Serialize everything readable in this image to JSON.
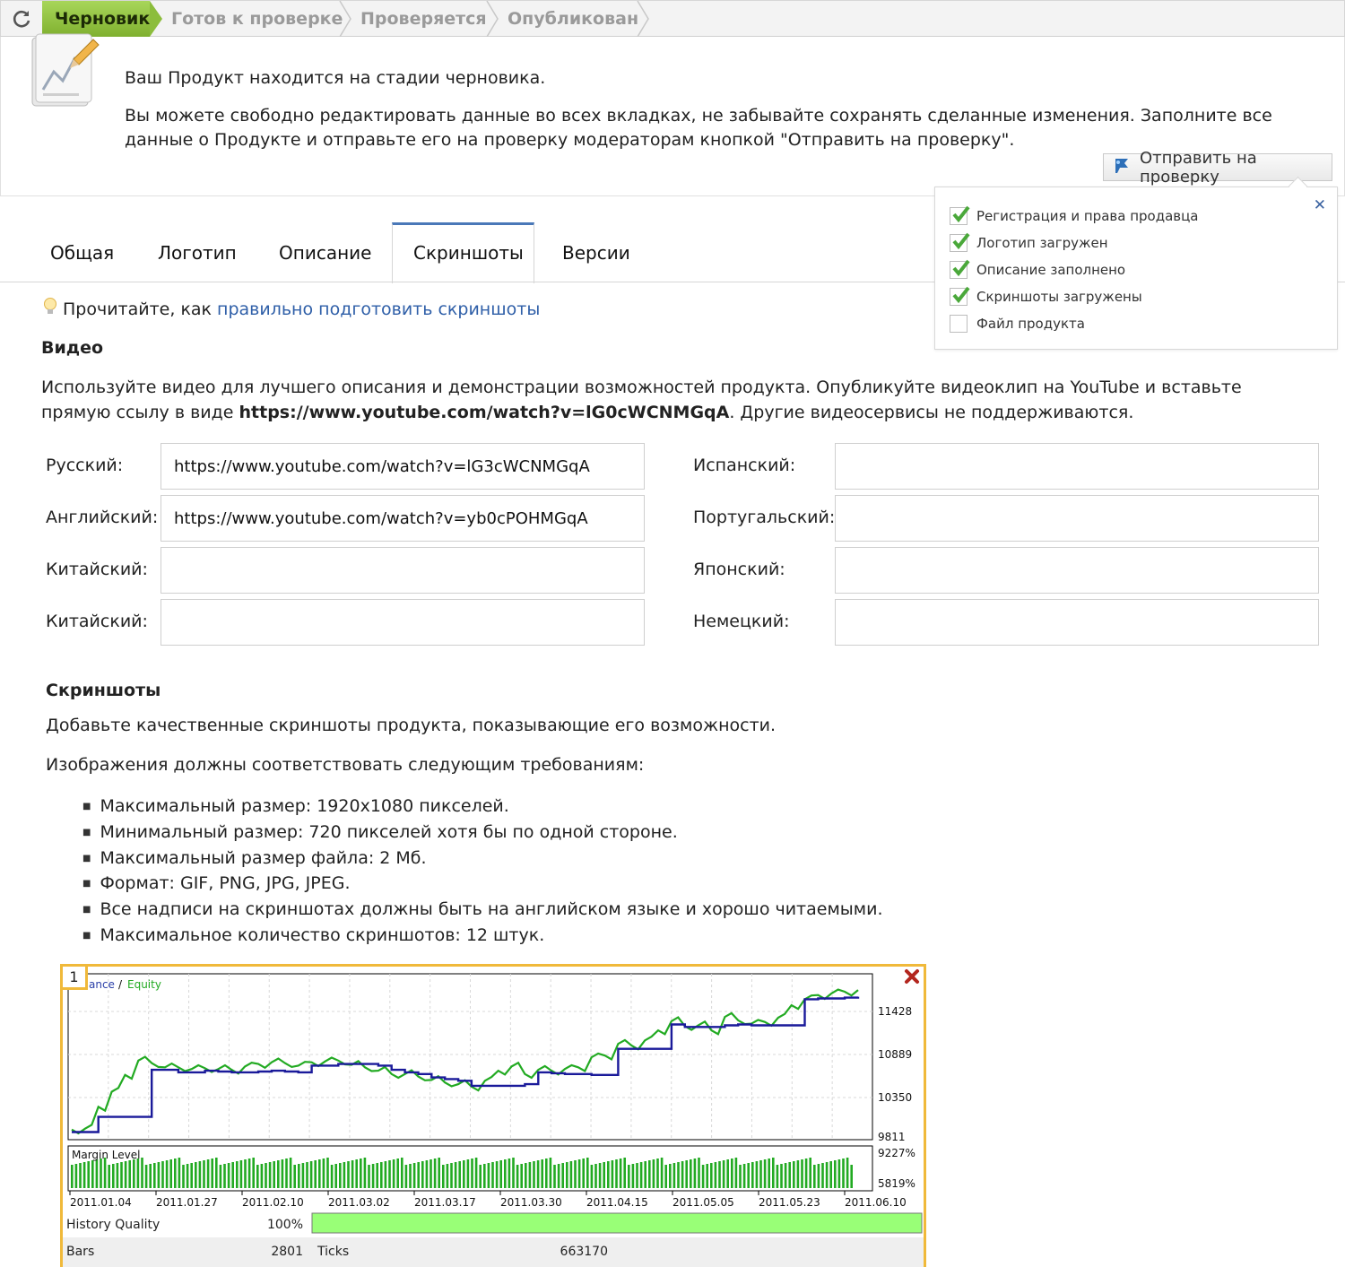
{
  "statusbar": {
    "steps": [
      {
        "label": "Черновик",
        "active": true
      },
      {
        "label": "Готов к проверке",
        "active": false
      },
      {
        "label": "Проверяется",
        "active": false
      },
      {
        "label": "Опубликован",
        "active": false
      }
    ]
  },
  "info": {
    "line1": "Ваш Продукт находится на стадии черновика.",
    "line2": "Вы можете свободно редактировать данные во всех вкладках, не забывайте сохранять сделанные изменения. Заполните все данные о Продукте и отправьте его на проверку модераторам кнопкой \"Отправить на проверку\".",
    "send_button": "Отправить на проверку"
  },
  "checklist": [
    {
      "label": "Регистрация и права продавца",
      "checked": true
    },
    {
      "label": "Логотип загружен",
      "checked": true
    },
    {
      "label": "Описание заполнено",
      "checked": true
    },
    {
      "label": "Скриншоты загружены",
      "checked": true
    },
    {
      "label": "Файл продукта",
      "checked": false
    }
  ],
  "tabs": [
    "Общая",
    "Логотип",
    "Описание",
    "Скриншоты",
    "Версии"
  ],
  "active_tab": "Скриншоты",
  "hint": {
    "prefix": "Прочитайте, как",
    "link": "правильно подготовить скриншоты"
  },
  "video": {
    "heading": "Видео",
    "desc_pre": "Используйте видео для лучшего описания и демонстрации возможностей продукта. Опубликуйте видеоклип на YouTube и вставьте прямую ссылу в виде ",
    "desc_url": "https://www.youtube.com/watch?v=lG0cWCNMGqA",
    "desc_post": ". Другие видеосервисы не поддерживаются.",
    "fields_left": [
      {
        "label": "Русский:",
        "value": "https://www.youtube.com/watch?v=lG3cWCNMGqA"
      },
      {
        "label": "Английский:",
        "value": "https://www.youtube.com/watch?v=yb0cPOHMGqA"
      },
      {
        "label": "Китайский:",
        "value": ""
      },
      {
        "label": "Китайский:",
        "value": ""
      }
    ],
    "fields_right": [
      {
        "label": "Испанский:",
        "value": ""
      },
      {
        "label": "Португальский:",
        "value": ""
      },
      {
        "label": "Японский:",
        "value": ""
      },
      {
        "label": "Немецкий:",
        "value": ""
      }
    ]
  },
  "screenshots": {
    "heading": "Скриншоты",
    "p1": "Добавьте качественные скриншоты продукта, показывающие его возможности.",
    "p2": "Изображения должны соответствовать следующим требованиям:",
    "requirements": [
      "Максимальный размер: 1920x1080 пикселей.",
      "Минимальный размер: 720 пикселей хотя бы по одной стороне.",
      "Максимальный размер файла: 2 Мб.",
      "Формат: GIF, PNG, JPG, JPEG.",
      "Все надписи на скриншотах должны быть на английском языке и хорошо читаемыми.",
      "Максимальное количество скриншотов: 12 штук."
    ],
    "item_number": "1"
  },
  "chart_data": {
    "type": "line",
    "legend": [
      "ance",
      "Equity"
    ],
    "colors": {
      "balance": "#1a1a9a",
      "equity": "#22aa22",
      "margin": "#22aa22",
      "quality": "#99ff77",
      "frame": "#f0b93a"
    },
    "y_ticks": [
      "11428",
      "10889",
      "10350",
      "9811"
    ],
    "ylim": [
      9811,
      11700
    ],
    "x_labels": [
      "2011.01.04",
      "2011.01.27",
      "2011.02.10",
      "2011.03.02",
      "2011.03.17",
      "2011.03.30",
      "2011.04.15",
      "2011.05.05",
      "2011.05.23",
      "2011.06.10"
    ],
    "balance": [
      9870,
      9870,
      10050,
      10050,
      10050,
      10050,
      10610,
      10610,
      10580,
      10580,
      10600,
      10590,
      10580,
      10580,
      10590,
      10600,
      10590,
      10580,
      10660,
      10660,
      10680,
      10680,
      10680,
      10660,
      10610,
      10580,
      10560,
      10520,
      10500,
      10480,
      10420,
      10420,
      10420,
      10420,
      10440,
      10580,
      10570,
      10560,
      10560,
      10550,
      10550,
      10860,
      10860,
      10860,
      10860,
      11150,
      11120,
      11120,
      11120,
      11140,
      11150,
      11140,
      11140,
      11140,
      11140,
      11450,
      11460,
      11460,
      11470,
      11480
    ],
    "equity": [
      9900,
      9910,
      10170,
      10350,
      10550,
      10720,
      10690,
      10640,
      10640,
      10620,
      10630,
      10620,
      10610,
      10650,
      10680,
      10700,
      10690,
      10660,
      10700,
      10710,
      10720,
      10670,
      10640,
      10600,
      10560,
      10560,
      10530,
      10490,
      10460,
      10440,
      10410,
      10480,
      10600,
      10650,
      10560,
      10610,
      10600,
      10620,
      10640,
      10760,
      10780,
      10920,
      10900,
      10960,
      11080,
      11190,
      11130,
      11140,
      11080,
      11240,
      11200,
      11160,
      11180,
      11230,
      11380,
      11450,
      11500,
      11520,
      11540,
      11560
    ],
    "margin_labels": [
      "Margin Level",
      "9227%",
      "5819%"
    ],
    "stats": [
      {
        "label": "History Quality",
        "value": "100%",
        "fill": 1.0
      },
      {
        "label": "Bars",
        "value": "2801",
        "label2": "Ticks",
        "value2": "663170"
      }
    ]
  }
}
